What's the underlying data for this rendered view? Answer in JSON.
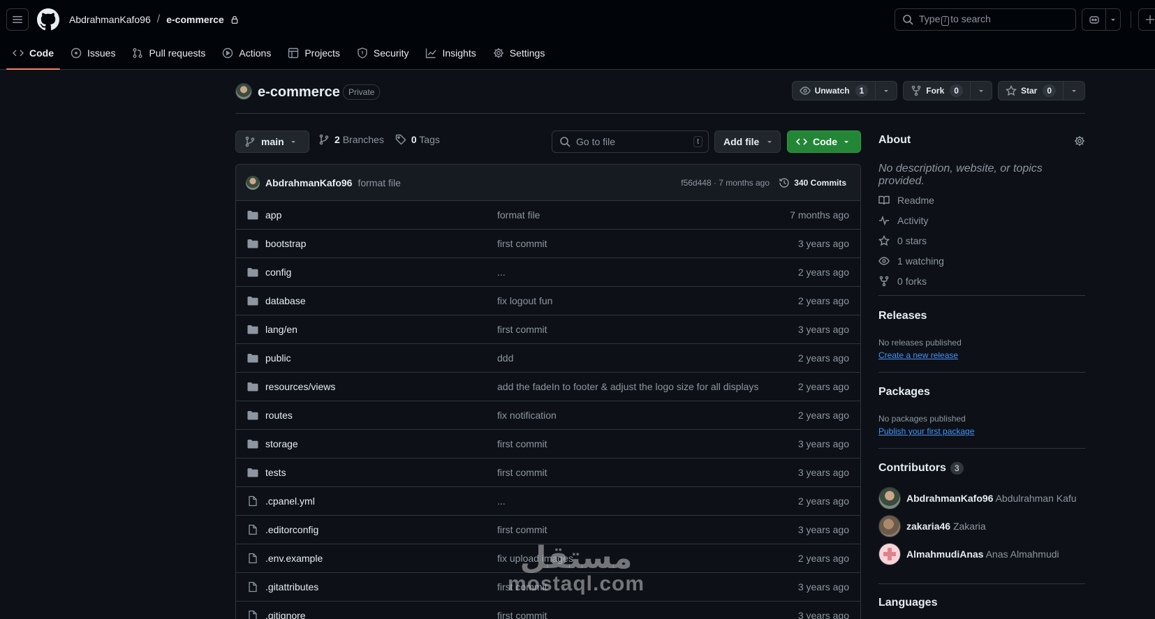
{
  "header": {
    "owner": "AbdrahmanKafo96",
    "separator": "/",
    "repo": "e-commerce",
    "search": {
      "prefix": "Type",
      "key": "/",
      "suffix": "to search"
    }
  },
  "tabs": [
    {
      "label": "Code",
      "icon": "code-icon",
      "active": true
    },
    {
      "label": "Issues",
      "icon": "issue-icon"
    },
    {
      "label": "Pull requests",
      "icon": "pull-request-icon"
    },
    {
      "label": "Actions",
      "icon": "play-icon"
    },
    {
      "label": "Projects",
      "icon": "table-icon"
    },
    {
      "label": "Security",
      "icon": "shield-icon"
    },
    {
      "label": "Insights",
      "icon": "graph-icon"
    },
    {
      "label": "Settings",
      "icon": "gear-icon"
    }
  ],
  "repo_head": {
    "name": "e-commerce",
    "visibility": "Private",
    "unwatch": {
      "label": "Unwatch",
      "count": "1"
    },
    "fork": {
      "label": "Fork",
      "count": "0"
    },
    "star": {
      "label": "Star",
      "count": "0"
    }
  },
  "branch": {
    "current": "main",
    "branches_count": "2",
    "branches_label": "Branches",
    "tags_count": "0",
    "tags_label": "Tags",
    "goto_placeholder": "Go to file",
    "goto_key": "t",
    "add_file": "Add file",
    "code": "Code"
  },
  "latest_commit": {
    "author": "AbdrahmanKafo96",
    "message": "format file",
    "sha_age": "f56d448 · 7 months ago",
    "commits": "340 Commits"
  },
  "files": [
    {
      "type": "dir",
      "name": "app",
      "message": "format file",
      "age": "7 months ago"
    },
    {
      "type": "dir",
      "name": "bootstrap",
      "message": "first commit",
      "age": "3 years ago"
    },
    {
      "type": "dir",
      "name": "config",
      "message": "...",
      "age": "2 years ago"
    },
    {
      "type": "dir",
      "name": "database",
      "message": "fix logout fun",
      "age": "2 years ago"
    },
    {
      "type": "dir",
      "name": "lang/en",
      "message": "first commit",
      "age": "3 years ago"
    },
    {
      "type": "dir",
      "name": "public",
      "message": "ddd",
      "age": "2 years ago"
    },
    {
      "type": "dir",
      "name": "resources/views",
      "message": "add the fadeIn to footer & adjust the logo size for all displays",
      "age": "2 years ago"
    },
    {
      "type": "dir",
      "name": "routes",
      "message": "fix notification",
      "age": "2 years ago"
    },
    {
      "type": "dir",
      "name": "storage",
      "message": "first commit",
      "age": "3 years ago"
    },
    {
      "type": "dir",
      "name": "tests",
      "message": "first commit",
      "age": "3 years ago"
    },
    {
      "type": "file",
      "name": ".cpanel.yml",
      "message": "...",
      "age": "2 years ago"
    },
    {
      "type": "file",
      "name": ".editorconfig",
      "message": "first commit",
      "age": "3 years ago"
    },
    {
      "type": "file",
      "name": ".env.example",
      "message": "fix upload images",
      "age": "2 years ago"
    },
    {
      "type": "file",
      "name": ".gitattributes",
      "message": "first commit",
      "age": "3 years ago"
    },
    {
      "type": "file",
      "name": ".gitignore",
      "message": "first commit",
      "age": "3 years ago"
    }
  ],
  "sidebar": {
    "about_title": "About",
    "about_desc": "No description, website, or topics provided.",
    "links": [
      {
        "icon": "book-icon",
        "count": "",
        "label": "Readme"
      },
      {
        "icon": "pulse-icon",
        "count": "",
        "label": "Activity"
      },
      {
        "icon": "star-icon",
        "count": "0",
        "label": "stars"
      },
      {
        "icon": "eye-icon",
        "count": "1",
        "label": "watching"
      },
      {
        "icon": "fork-icon",
        "count": "0",
        "label": "forks"
      }
    ],
    "releases_title": "Releases",
    "releases_none": "No releases published",
    "releases_link": "Create a new release",
    "packages_title": "Packages",
    "packages_none": "No packages published",
    "packages_link": "Publish your first package",
    "contributors_title": "Contributors",
    "contributors_count": "3",
    "contributors": [
      {
        "login": "AbdrahmanKafo96",
        "name": "Abdulrahman Kafu"
      },
      {
        "login": "zakaria46",
        "name": "Zakaria"
      },
      {
        "login": "AlmahmudiAnas",
        "name": "Anas Almahmudi"
      }
    ],
    "languages_title": "Languages"
  },
  "watermark": {
    "arabic": "مستقل",
    "latin": "mostaql.com"
  },
  "colors": {
    "background": "#0d1117",
    "header": "#010409",
    "accent": "#f78166",
    "primary_button": "#238636",
    "link": "#4493f8"
  }
}
